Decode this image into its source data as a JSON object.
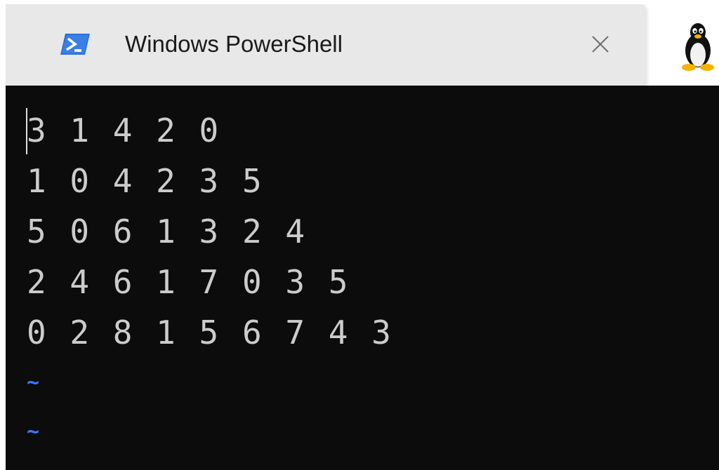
{
  "tab": {
    "title": "Windows PowerShell",
    "icon": "powershell-icon",
    "close_icon": "close-icon"
  },
  "second_tab": {
    "icon": "linux-penguin-icon"
  },
  "terminal": {
    "lines": [
      "3 1 4 2 0",
      "1 0 4 2 3 5",
      "5 0 6 1 3 2 4",
      "2 4 6 1 7 0 3 5",
      "0 2 8 1 5 6 7 4 3"
    ],
    "tildes": [
      "~",
      "~"
    ]
  },
  "colors": {
    "background": "#0c0c0c",
    "text": "#cccccc",
    "tilde": "#3b78ff",
    "tab_active": "#e8e8e8"
  }
}
